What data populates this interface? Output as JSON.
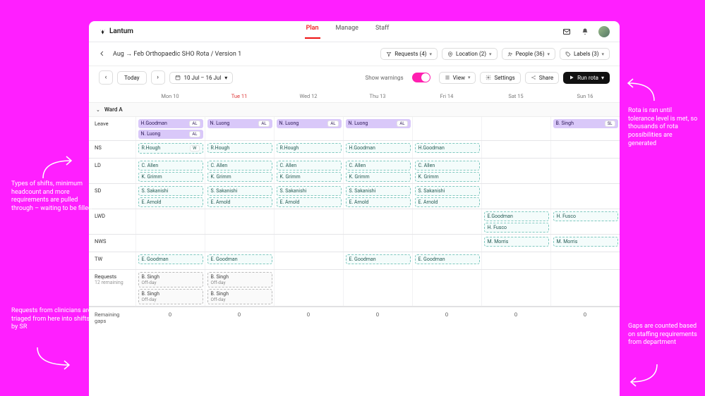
{
  "brand": "Lantum",
  "tabs": {
    "plan": "Plan",
    "manage": "Manage",
    "staff": "Staff"
  },
  "crumb": "Aug → Feb Orthopaedic SHO Rota / Version 1",
  "chips": {
    "requests": "Requests (4)",
    "location": "Location (2)",
    "people": "People (36)",
    "labels": "Labels (3)"
  },
  "toolbar": {
    "today": "Today",
    "date": "10 Jul – 16 Jul",
    "warnings": "Show warnings",
    "view": "View",
    "settings": "Settings",
    "share": "Share",
    "run": "Run rota"
  },
  "days": [
    "Mon  10",
    "Tue  11",
    "Wed  12",
    "Thu  13",
    "Fri  14",
    "Sat  15",
    "Sun  16"
  ],
  "ward": "Ward A",
  "rows": {
    "leave": "Leave",
    "ns": "NS",
    "ld": "LD",
    "sd": "SD",
    "lwd": "LWD",
    "nws": "NWS",
    "tw": "TW",
    "req": "Requests",
    "reqsub": "12 remaining",
    "gaps": "Remaining gaps"
  },
  "staff": {
    "hg": "H.Goodman",
    "nl": "N. Luong",
    "rh": "R.Hough",
    "ca": "C. Allen",
    "kg": "K. Grimm",
    "ss": "S. Sakanishi",
    "ea": "E. Arnold",
    "eg": "E.Goodman",
    "egf": "E. Goodman",
    "hf": "H. Fusco",
    "mm": "M. Morris",
    "bs": "B. Singh"
  },
  "tags": {
    "al": "AL",
    "w": "W",
    "sl": "SL"
  },
  "misc": {
    "offday": "Off-day"
  },
  "gap_values": [
    "0",
    "0",
    "0",
    "0",
    "0",
    "0",
    "0"
  ],
  "annotations": {
    "a1": "Types of shifts, minimum headcount and more requirements are pulled through – waiting to be filled",
    "a2": "Requests from clinicians are triaged from here into shifts by SR",
    "a3": "Rota is ran until tolerance level is met, so thousands of rota possibilities are generated",
    "a4": "Gaps are counted based on staffing requirements from department"
  }
}
